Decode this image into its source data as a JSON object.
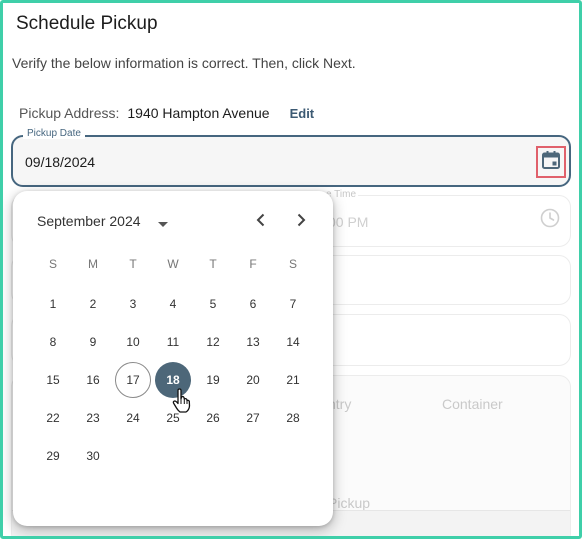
{
  "page": {
    "title": "Schedule Pickup",
    "instructions": "Verify the below information is correct. Then, click Next.",
    "address_label": "Pickup Address:",
    "address_value": "1940 Hampton Avenue",
    "edit_label": "Edit"
  },
  "date_field": {
    "label": "Pickup Date",
    "value": "09/18/2024"
  },
  "background_fields": {
    "time_label_fragment": "e Time",
    "time_value_fragment": "00 PM",
    "col_country_fragment": "ntry",
    "col_container": "Container",
    "pickup_fragment": "Pickup"
  },
  "calendar": {
    "month_year": "September 2024",
    "weekdays": [
      "S",
      "M",
      "T",
      "W",
      "T",
      "F",
      "S"
    ],
    "today_day": "17",
    "selected_day": "18",
    "weeks": [
      [
        "1",
        "2",
        "3",
        "4",
        "5",
        "6",
        "7"
      ],
      [
        "8",
        "9",
        "10",
        "11",
        "12",
        "13",
        "14"
      ],
      [
        "15",
        "16",
        "17",
        "18",
        "19",
        "20",
        "21"
      ],
      [
        "22",
        "23",
        "24",
        "25",
        "26",
        "27",
        "28"
      ],
      [
        "29",
        "30"
      ]
    ]
  },
  "icons": {
    "calendar": "calendar-icon",
    "clock": "clock-icon",
    "dropdown": "caret-down-icon",
    "prev": "chevron-left-icon",
    "next": "chevron-right-icon",
    "cursor": "hand-pointer-icon"
  },
  "colors": {
    "accent": "#4d6779",
    "focus_border": "#46667f",
    "highlight_box": "#e0606b",
    "frame": "#3fcfa9"
  }
}
